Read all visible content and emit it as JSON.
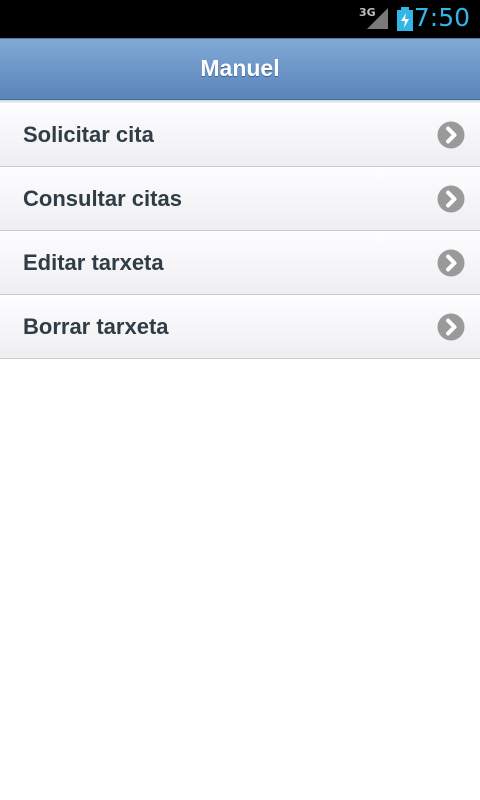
{
  "status_bar": {
    "network": "3G",
    "time": "7:50",
    "signal_icon": "signal-icon",
    "battery_icon": "battery-charging-icon"
  },
  "header": {
    "title": "Manuel"
  },
  "menu": {
    "items": [
      {
        "label": "Solicitar cita",
        "icon": "chevron-right-icon"
      },
      {
        "label": "Consultar citas",
        "icon": "chevron-right-icon"
      },
      {
        "label": "Editar tarxeta",
        "icon": "chevron-right-icon"
      },
      {
        "label": "Borrar tarxeta",
        "icon": "chevron-right-icon"
      }
    ]
  },
  "colors": {
    "header": "#6b95c7",
    "clock": "#33b5e5",
    "label": "#2f3e46",
    "arrow": "#9a9a9a"
  }
}
